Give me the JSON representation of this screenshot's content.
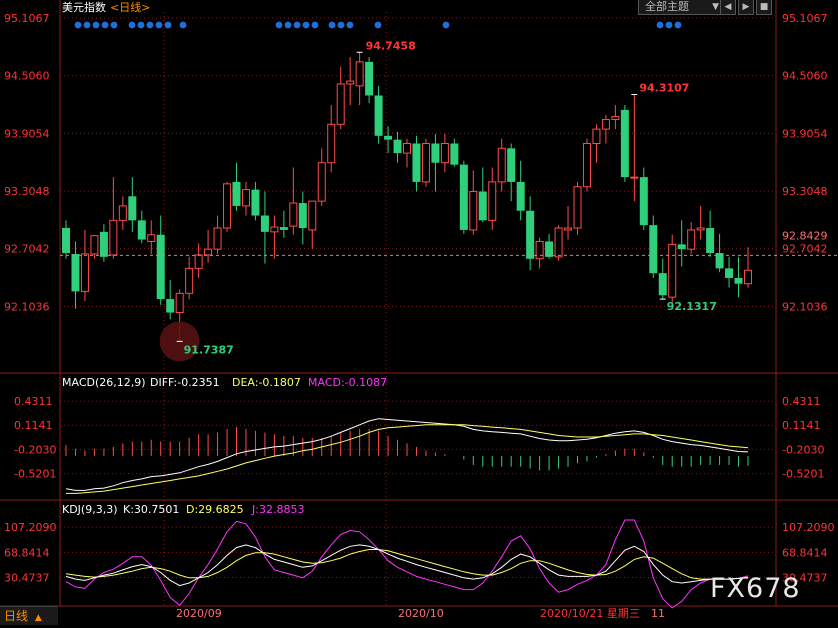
{
  "header": {
    "title": "美元指数",
    "period": "<日线>",
    "dropdown_label": "全部主题",
    "dropdown_arrow": "▼",
    "nav_left": "◀",
    "nav_right": "▶",
    "nav_close": "■"
  },
  "colors": {
    "up": "#ff4b4b",
    "down": "#2fd07c",
    "price_label": "#ff3333",
    "low_label": "#2fd07c",
    "diff": "#ffffff",
    "dea": "#ffff66",
    "macd": "#ff33ff",
    "k": "#ffffff",
    "d": "#ffff66",
    "j": "#ff33ff",
    "grid": "#8b1a1a",
    "dots": "#1e6fd8"
  },
  "chart_data": [
    {
      "type": "candlestick",
      "name": "美元指数 日线",
      "y_ticks": [
        "95.1067",
        "94.5060",
        "93.9054",
        "93.3048",
        "92.7042",
        "92.1036"
      ],
      "ylim": [
        91.65,
        95.1067
      ],
      "current_price": "92.8429",
      "annotations": {
        "high": "94.7458",
        "low": "91.7387",
        "recent_high": "94.3107",
        "recent_low": "92.1317"
      },
      "candles": [
        {
          "o": 92.92,
          "h": 93.0,
          "l": 92.6,
          "c": 92.66
        },
        {
          "o": 92.65,
          "h": 92.78,
          "l": 92.08,
          "c": 92.26
        },
        {
          "o": 92.26,
          "h": 92.9,
          "l": 92.16,
          "c": 92.65
        },
        {
          "o": 92.65,
          "h": 92.85,
          "l": 92.6,
          "c": 92.84
        },
        {
          "o": 92.88,
          "h": 92.96,
          "l": 92.57,
          "c": 92.62
        },
        {
          "o": 92.64,
          "h": 93.45,
          "l": 92.6,
          "c": 93.0
        },
        {
          "o": 93.0,
          "h": 93.25,
          "l": 92.9,
          "c": 93.15
        },
        {
          "o": 93.25,
          "h": 93.45,
          "l": 92.88,
          "c": 93.0
        },
        {
          "o": 93.0,
          "h": 93.1,
          "l": 92.76,
          "c": 92.8
        },
        {
          "o": 92.78,
          "h": 93.0,
          "l": 92.65,
          "c": 92.85
        },
        {
          "o": 92.85,
          "h": 93.05,
          "l": 92.12,
          "c": 92.18
        },
        {
          "o": 92.18,
          "h": 92.38,
          "l": 91.97,
          "c": 92.04
        },
        {
          "o": 92.04,
          "h": 92.28,
          "l": 91.74,
          "c": 92.24
        },
        {
          "o": 92.24,
          "h": 92.62,
          "l": 92.18,
          "c": 92.5
        },
        {
          "o": 92.5,
          "h": 92.76,
          "l": 92.4,
          "c": 92.64
        },
        {
          "o": 92.64,
          "h": 92.9,
          "l": 92.56,
          "c": 92.7
        },
        {
          "o": 92.7,
          "h": 93.05,
          "l": 92.65,
          "c": 92.92
        },
        {
          "o": 92.92,
          "h": 93.4,
          "l": 92.88,
          "c": 93.38
        },
        {
          "o": 93.4,
          "h": 93.6,
          "l": 93.1,
          "c": 93.15
        },
        {
          "o": 93.15,
          "h": 93.4,
          "l": 93.05,
          "c": 93.32
        },
        {
          "o": 93.32,
          "h": 93.4,
          "l": 93.0,
          "c": 93.05
        },
        {
          "o": 93.05,
          "h": 93.3,
          "l": 92.55,
          "c": 92.88
        },
        {
          "o": 92.88,
          "h": 93.05,
          "l": 92.6,
          "c": 92.93
        },
        {
          "o": 92.93,
          "h": 93.1,
          "l": 92.82,
          "c": 92.9
        },
        {
          "o": 92.94,
          "h": 93.55,
          "l": 92.85,
          "c": 93.18
        },
        {
          "o": 93.18,
          "h": 93.3,
          "l": 92.75,
          "c": 92.92
        },
        {
          "o": 92.9,
          "h": 93.2,
          "l": 92.7,
          "c": 93.2
        },
        {
          "o": 93.2,
          "h": 93.75,
          "l": 93.15,
          "c": 93.6
        },
        {
          "o": 93.6,
          "h": 94.2,
          "l": 93.5,
          "c": 94.0
        },
        {
          "o": 94.0,
          "h": 94.6,
          "l": 93.95,
          "c": 94.42
        },
        {
          "o": 94.42,
          "h": 94.7,
          "l": 94.2,
          "c": 94.45
        },
        {
          "o": 94.4,
          "h": 94.75,
          "l": 94.2,
          "c": 94.65
        },
        {
          "o": 94.65,
          "h": 94.7,
          "l": 94.22,
          "c": 94.3
        },
        {
          "o": 94.3,
          "h": 94.4,
          "l": 93.8,
          "c": 93.88
        },
        {
          "o": 93.88,
          "h": 93.98,
          "l": 93.7,
          "c": 93.84
        },
        {
          "o": 93.84,
          "h": 93.92,
          "l": 93.6,
          "c": 93.7
        },
        {
          "o": 93.7,
          "h": 93.85,
          "l": 93.55,
          "c": 93.8
        },
        {
          "o": 93.8,
          "h": 93.88,
          "l": 93.3,
          "c": 93.4
        },
        {
          "o": 93.4,
          "h": 93.85,
          "l": 93.35,
          "c": 93.8
        },
        {
          "o": 93.8,
          "h": 93.9,
          "l": 93.3,
          "c": 93.6
        },
        {
          "o": 93.6,
          "h": 93.9,
          "l": 93.5,
          "c": 93.8
        },
        {
          "o": 93.8,
          "h": 93.85,
          "l": 93.56,
          "c": 93.58
        },
        {
          "o": 93.58,
          "h": 93.62,
          "l": 92.86,
          "c": 92.9
        },
        {
          "o": 92.9,
          "h": 93.52,
          "l": 92.85,
          "c": 93.3
        },
        {
          "o": 93.3,
          "h": 93.55,
          "l": 92.98,
          "c": 93.0
        },
        {
          "o": 93.0,
          "h": 93.55,
          "l": 92.9,
          "c": 93.4
        },
        {
          "o": 93.4,
          "h": 93.85,
          "l": 93.3,
          "c": 93.75
        },
        {
          "o": 93.75,
          "h": 93.8,
          "l": 93.2,
          "c": 93.4
        },
        {
          "o": 93.4,
          "h": 93.62,
          "l": 93.0,
          "c": 93.1
        },
        {
          "o": 93.1,
          "h": 93.25,
          "l": 92.48,
          "c": 92.6
        },
        {
          "o": 92.6,
          "h": 92.82,
          "l": 92.5,
          "c": 92.78
        },
        {
          "o": 92.78,
          "h": 92.86,
          "l": 92.6,
          "c": 92.62
        },
        {
          "o": 92.62,
          "h": 92.95,
          "l": 92.58,
          "c": 92.92
        },
        {
          "o": 92.9,
          "h": 93.15,
          "l": 92.8,
          "c": 92.92
        },
        {
          "o": 92.92,
          "h": 93.4,
          "l": 92.85,
          "c": 93.35
        },
        {
          "o": 93.35,
          "h": 93.85,
          "l": 93.3,
          "c": 93.8
        },
        {
          "o": 93.8,
          "h": 94.0,
          "l": 93.6,
          "c": 93.95
        },
        {
          "o": 93.95,
          "h": 94.1,
          "l": 93.8,
          "c": 94.05
        },
        {
          "o": 94.05,
          "h": 94.2,
          "l": 93.95,
          "c": 94.08
        },
        {
          "o": 94.15,
          "h": 94.2,
          "l": 93.4,
          "c": 93.45
        },
        {
          "o": 93.45,
          "h": 94.31,
          "l": 93.2,
          "c": 93.45
        },
        {
          "o": 93.45,
          "h": 93.55,
          "l": 92.9,
          "c": 92.95
        },
        {
          "o": 92.95,
          "h": 93.05,
          "l": 92.4,
          "c": 92.45
        },
        {
          "o": 92.45,
          "h": 92.6,
          "l": 92.18,
          "c": 92.22
        },
        {
          "o": 92.2,
          "h": 92.85,
          "l": 92.13,
          "c": 92.75
        },
        {
          "o": 92.75,
          "h": 93.0,
          "l": 92.52,
          "c": 92.7
        },
        {
          "o": 92.7,
          "h": 92.98,
          "l": 92.65,
          "c": 92.9
        },
        {
          "o": 92.9,
          "h": 93.15,
          "l": 92.8,
          "c": 92.92
        },
        {
          "o": 92.92,
          "h": 93.1,
          "l": 92.62,
          "c": 92.66
        },
        {
          "o": 92.66,
          "h": 92.86,
          "l": 92.46,
          "c": 92.5
        },
        {
          "o": 92.5,
          "h": 92.62,
          "l": 92.3,
          "c": 92.4
        },
        {
          "o": 92.4,
          "h": 92.62,
          "l": 92.2,
          "c": 92.34
        },
        {
          "o": 92.34,
          "h": 92.72,
          "l": 92.3,
          "c": 92.48
        }
      ]
    },
    {
      "type": "macd",
      "title": "MACD(26,12,9)",
      "diff_label": "DIFF:-0.2351",
      "dea_label": "DEA:-0.1807",
      "macd_label": "MACD:-0.1087",
      "y_ticks": [
        "0.4311",
        "0.1141",
        "-0.2030",
        "-0.5201"
      ],
      "ylim": [
        -0.84,
        0.55
      ],
      "diff": [
        -0.72,
        -0.74,
        -0.74,
        -0.72,
        -0.71,
        -0.68,
        -0.64,
        -0.61,
        -0.59,
        -0.56,
        -0.55,
        -0.53,
        -0.51,
        -0.47,
        -0.43,
        -0.4,
        -0.36,
        -0.31,
        -0.26,
        -0.23,
        -0.21,
        -0.19,
        -0.17,
        -0.16,
        -0.14,
        -0.12,
        -0.1,
        -0.07,
        -0.03,
        0.02,
        0.07,
        0.12,
        0.17,
        0.2,
        0.19,
        0.18,
        0.17,
        0.16,
        0.15,
        0.14,
        0.13,
        0.12,
        0.1,
        0.06,
        0.04,
        0.03,
        0.02,
        0.01,
        0.0,
        -0.03,
        -0.06,
        -0.08,
        -0.09,
        -0.09,
        -0.08,
        -0.07,
        -0.05,
        -0.02,
        0.01,
        0.03,
        0.04,
        0.02,
        -0.02,
        -0.07,
        -0.1,
        -0.12,
        -0.14,
        -0.15,
        -0.17,
        -0.19,
        -0.21,
        -0.23,
        -0.235
      ],
      "dea": [
        -0.78,
        -0.78,
        -0.77,
        -0.76,
        -0.75,
        -0.73,
        -0.71,
        -0.69,
        -0.67,
        -0.65,
        -0.63,
        -0.61,
        -0.59,
        -0.57,
        -0.55,
        -0.52,
        -0.49,
        -0.46,
        -0.42,
        -0.38,
        -0.35,
        -0.32,
        -0.29,
        -0.27,
        -0.25,
        -0.22,
        -0.2,
        -0.17,
        -0.14,
        -0.11,
        -0.07,
        -0.03,
        0.02,
        0.06,
        0.08,
        0.09,
        0.1,
        0.11,
        0.12,
        0.12,
        0.12,
        0.12,
        0.12,
        0.11,
        0.1,
        0.09,
        0.08,
        0.07,
        0.06,
        0.04,
        0.02,
        0.0,
        -0.02,
        -0.03,
        -0.04,
        -0.04,
        -0.04,
        -0.03,
        -0.02,
        -0.01,
        0.0,
        0.0,
        -0.01,
        -0.02,
        -0.04,
        -0.06,
        -0.08,
        -0.1,
        -0.12,
        -0.14,
        -0.16,
        -0.17,
        -0.1807
      ]
    },
    {
      "type": "kdj",
      "title": "KDJ(9,3,3)",
      "k_label": "K:30.7501",
      "d_label": "D:29.6825",
      "j_label": "J:32.8853",
      "y_ticks": [
        "107.2090",
        "68.8414",
        "30.4737"
      ],
      "ylim": [
        -10,
        118
      ],
      "k": [
        32,
        28,
        26,
        30,
        34,
        37,
        42,
        47,
        50,
        47,
        38,
        26,
        18,
        22,
        30,
        38,
        50,
        64,
        76,
        80,
        76,
        66,
        58,
        54,
        50,
        46,
        48,
        56,
        64,
        72,
        78,
        80,
        78,
        73,
        66,
        60,
        55,
        50,
        46,
        42,
        38,
        34,
        30,
        28,
        30,
        36,
        46,
        58,
        66,
        62,
        52,
        42,
        34,
        32,
        32,
        32,
        34,
        40,
        56,
        72,
        78,
        70,
        50,
        34,
        24,
        22,
        24,
        26,
        28,
        28,
        28,
        29,
        30.75
      ],
      "d": [
        36,
        34,
        32,
        31,
        32,
        34,
        37,
        40,
        44,
        46,
        44,
        40,
        34,
        30,
        30,
        32,
        38,
        46,
        56,
        64,
        68,
        68,
        66,
        62,
        58,
        54,
        52,
        53,
        56,
        60,
        66,
        70,
        73,
        73,
        71,
        67,
        63,
        59,
        55,
        51,
        47,
        43,
        39,
        36,
        34,
        34,
        38,
        44,
        52,
        56,
        56,
        52,
        47,
        42,
        38,
        35,
        34,
        35,
        40,
        48,
        58,
        62,
        60,
        52,
        44,
        36,
        30,
        28,
        28,
        28,
        28,
        29,
        29.68
      ],
      "j": [
        24,
        16,
        14,
        28,
        38,
        43,
        52,
        62,
        62,
        49,
        26,
        0,
        -12,
        6,
        30,
        50,
        74,
        100,
        116,
        112,
        92,
        62,
        42,
        38,
        34,
        30,
        40,
        62,
        80,
        96,
        102,
        100,
        88,
        73,
        56,
        46,
        39,
        32,
        28,
        24,
        20,
        16,
        12,
        12,
        22,
        40,
        62,
        86,
        94,
        74,
        44,
        22,
        8,
        12,
        20,
        26,
        34,
        50,
        88,
        118,
        118,
        86,
        30,
        -2,
        -16,
        -6,
        12,
        22,
        28,
        28,
        28,
        29,
        32.89
      ]
    }
  ],
  "x_axis": {
    "labels": [
      "2020/09",
      "2020/10",
      "2020/10/21 星期三",
      "11"
    ]
  },
  "signal_dots": "●●●●",
  "footer": {
    "period_button": "日线",
    "period_arrow": "▲",
    "watermark": "FX678"
  }
}
